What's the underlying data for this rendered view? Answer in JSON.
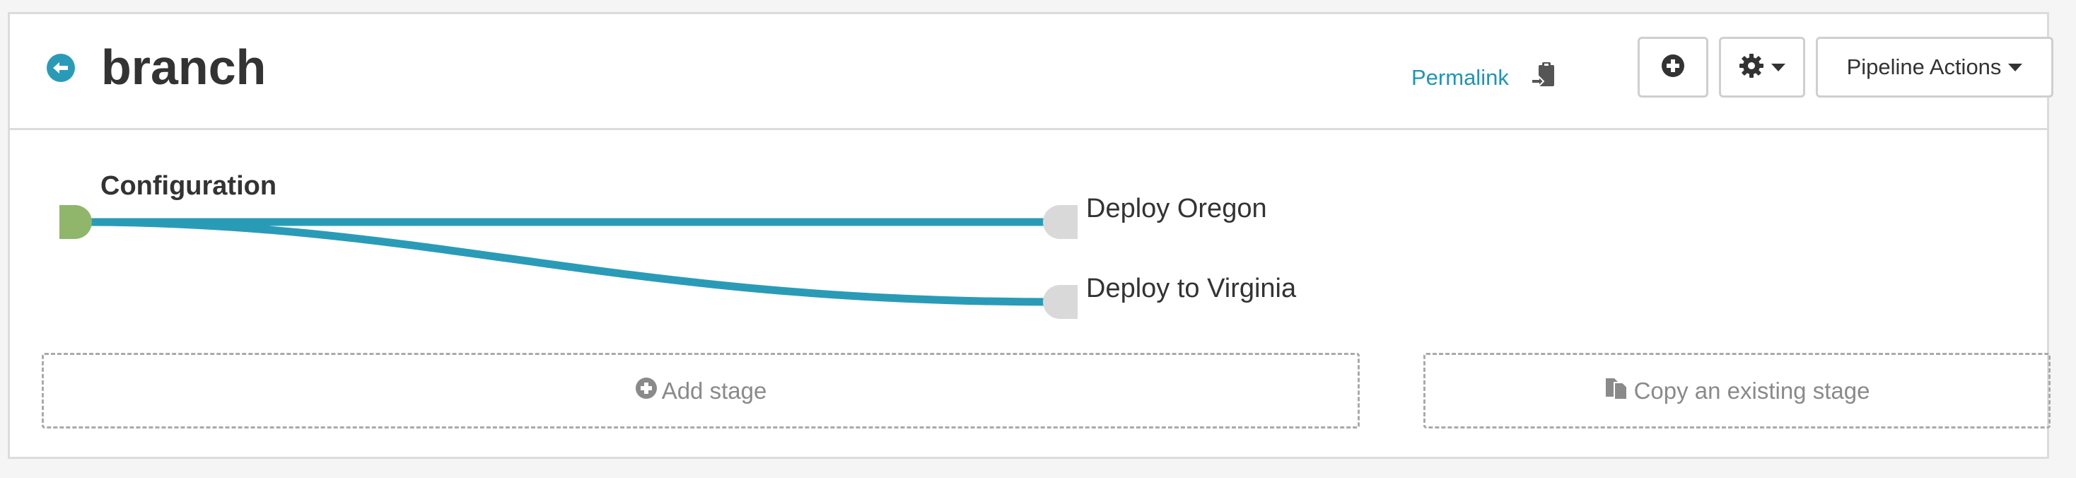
{
  "header": {
    "title": "branch",
    "permalink_label": "Permalink",
    "actions_label": "Pipeline Actions"
  },
  "stages": {
    "source": "Configuration",
    "targets": [
      "Deploy Oregon",
      "Deploy to Virginia"
    ]
  },
  "footer_actions": {
    "add_stage_label": "Add stage",
    "copy_stage_label": "Copy an existing stage"
  },
  "icons": {
    "back": "arrow-left-circle-icon",
    "copy_permalink": "clipboard-icon",
    "add": "plus-circle-icon",
    "settings": "gear-icon",
    "add_stage": "plus-circle-icon",
    "copy_stage": "copy-files-icon"
  },
  "colors": {
    "accent": "#2a9bb7",
    "link": "#1f95b5",
    "source_node": "#8fb66b",
    "target_node": "#d9d9d9"
  }
}
